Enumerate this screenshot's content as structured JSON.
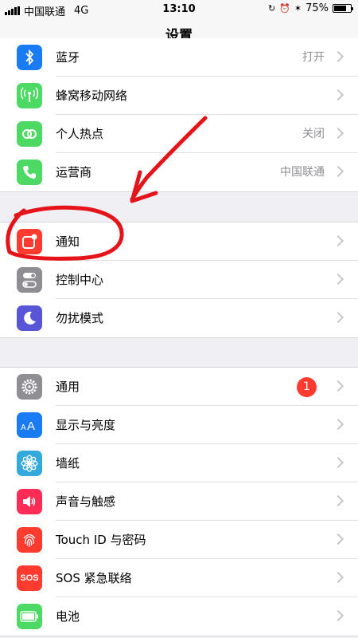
{
  "status_bar": {
    "carrier": "中国联通",
    "network": "4G",
    "time": "13:10",
    "battery": "75%",
    "battery_level": 0.75
  },
  "nav": {
    "title": "设置"
  },
  "group1": [
    {
      "label": "蓝牙",
      "value": "打开",
      "icon": "bluetooth-icon",
      "color": "#1a7cf5"
    },
    {
      "label": "蜂窝移动网络",
      "value": "",
      "icon": "antenna-icon",
      "color": "#4cd964"
    },
    {
      "label": "个人热点",
      "value": "关闭",
      "icon": "hotspot-icon",
      "color": "#4cd964"
    },
    {
      "label": "运营商",
      "value": "中国联通",
      "icon": "phone-icon",
      "color": "#4cd964"
    }
  ],
  "group2": [
    {
      "label": "通知",
      "icon": "notifications-icon",
      "color": "#ff3b30"
    },
    {
      "label": "控制中心",
      "icon": "control-center-icon",
      "color": "#8e8e93"
    },
    {
      "label": "勿扰模式",
      "icon": "moon-icon",
      "color": "#5856d6"
    }
  ],
  "group3": [
    {
      "label": "通用",
      "badge": "1",
      "icon": "gear-icon",
      "color": "#8e8e93"
    },
    {
      "label": "显示与亮度",
      "icon": "text-size-icon",
      "color": "#1a7cf5"
    },
    {
      "label": "墙纸",
      "icon": "flower-icon",
      "color": "#34aadc"
    },
    {
      "label": "声音与触感",
      "icon": "speaker-icon",
      "color": "#ff2d55"
    },
    {
      "label": "Touch ID 与密码",
      "icon": "fingerprint-icon",
      "color": "#ff3b30"
    },
    {
      "label": "SOS 紧急联络",
      "icon_text": "SOS",
      "icon": "sos-icon",
      "color": "#ff3b30"
    },
    {
      "label": "电池",
      "icon": "battery-icon",
      "color": "#4cd964"
    }
  ],
  "annotation": {
    "color": "#e5141b"
  }
}
